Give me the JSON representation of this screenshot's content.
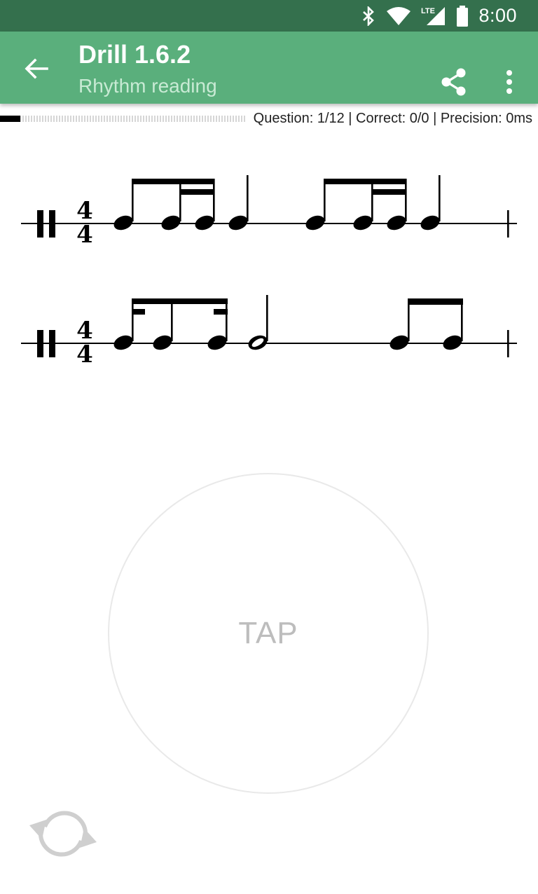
{
  "status_bar": {
    "time": "8:00",
    "network_label": "LTE",
    "icons": [
      "bluetooth-icon",
      "wifi-icon",
      "lte-signal-icon",
      "battery-icon"
    ]
  },
  "app_bar": {
    "title": "Drill 1.6.2",
    "subtitle": "Rhythm reading",
    "icons": [
      "back-arrow-icon",
      "share-icon",
      "more-vert-icon"
    ]
  },
  "progress": {
    "fraction": 0.083,
    "stats_text": "Question: 1/12 | Correct: 0/0 | Precision: 0ms"
  },
  "notation": {
    "time_signature": {
      "top": "4",
      "bottom": "4"
    },
    "rows": [
      {
        "groups": [
          "eighth-two-sixteenths",
          "quarter",
          "eighth-two-sixteenths",
          "quarter"
        ]
      },
      {
        "groups": [
          "sixteenth-eighth-sixteenth",
          "half",
          "eighth-pair"
        ]
      }
    ]
  },
  "tap": {
    "label": "TAP"
  },
  "refresh": {
    "icon": "refresh-icon"
  },
  "colors": {
    "status_bar": "#34704d",
    "app_bar": "#5aaf7c",
    "subtitle": "#c8ead4",
    "tap_text": "#bdbdbd",
    "tap_border": "#e9e9e9"
  }
}
